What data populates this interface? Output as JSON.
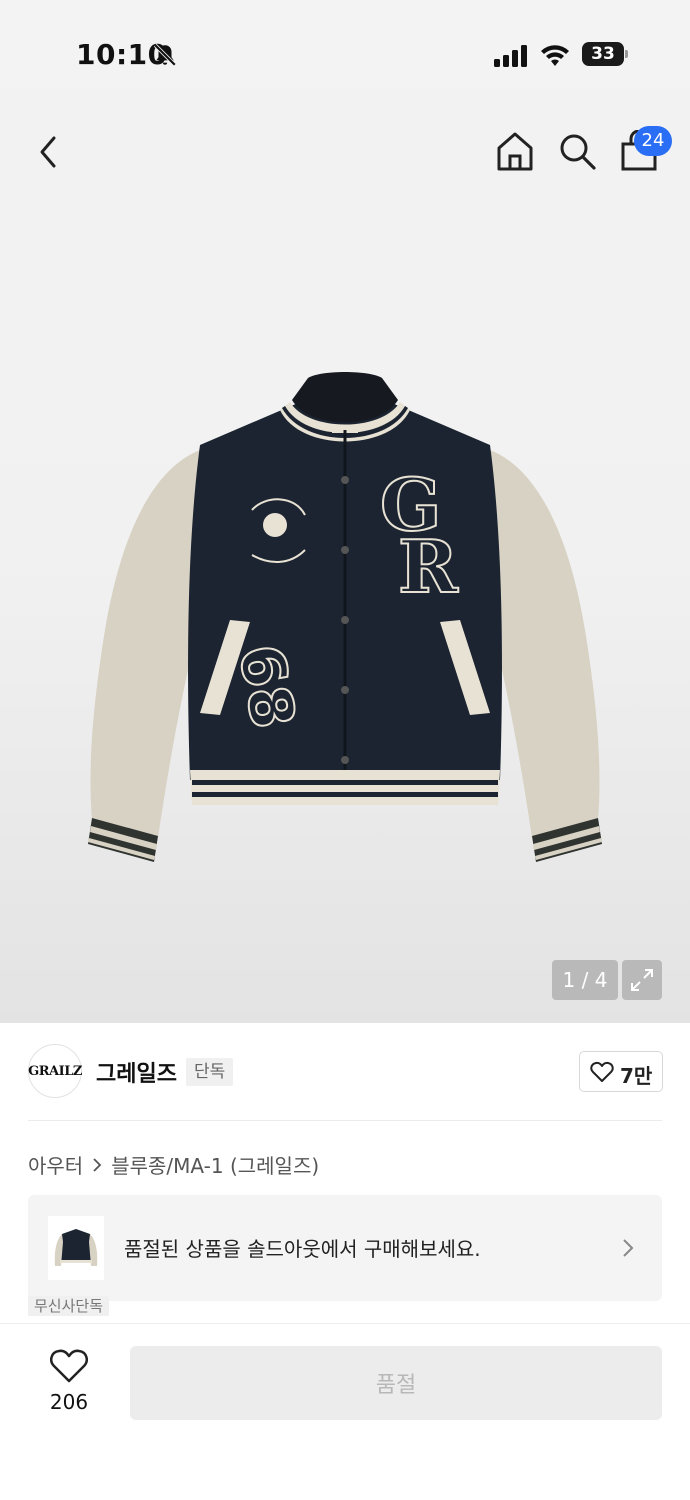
{
  "status_bar": {
    "time": "10:10",
    "battery": "33",
    "icons": [
      "bell-slash-icon",
      "signal-icon",
      "wifi-icon",
      "battery-icon"
    ]
  },
  "nav": {
    "back_icon": "chevron-left-icon",
    "home_icon": "home-icon",
    "search_icon": "search-icon",
    "bag_icon": "shopping-bag-icon",
    "bag_count": "24",
    "badge_color": "#2b6ef6"
  },
  "image": {
    "counter": "1 / 4",
    "expand_icon": "expand-icon",
    "jacket_logo_text": "GR",
    "jacket_number": "68"
  },
  "brand": {
    "logo_text": "GRAILZ",
    "name": "그레일즈",
    "tag": "단독",
    "likes": "7만"
  },
  "breadcrumb": {
    "category": "아우터",
    "subcategory": "블루종/MA-1 (그레일즈)"
  },
  "soldout_banner": {
    "text": "품절된 상품을 솔드아웃에서 구매해보세요."
  },
  "partial_chip": "무신사단독",
  "bottom_bar": {
    "wish_count": "206",
    "buy_label": "품절"
  }
}
